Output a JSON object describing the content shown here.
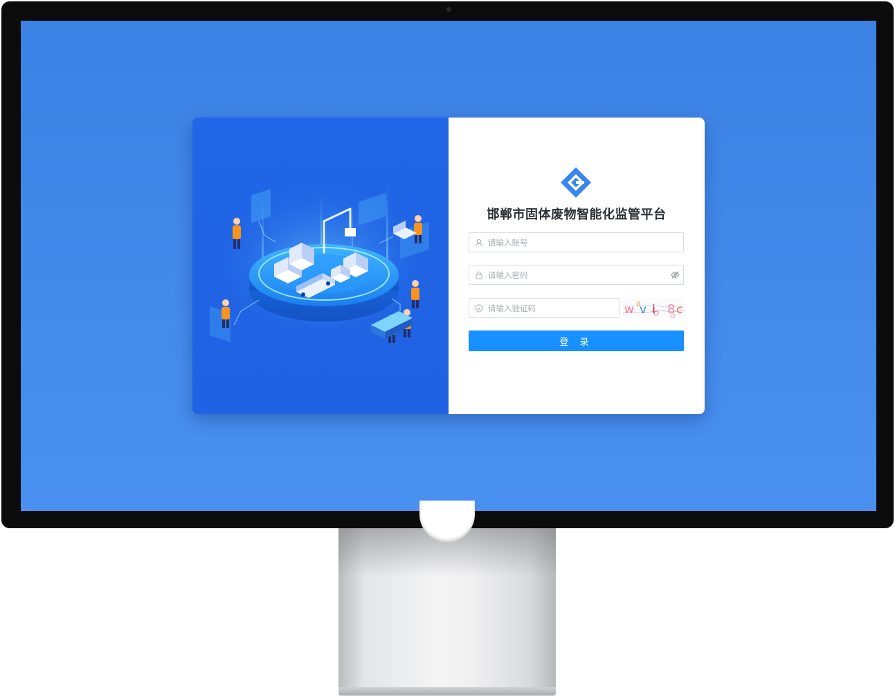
{
  "login": {
    "title": "邯郸市固体废物智能化监管平台",
    "account_placeholder": "请输入账号",
    "password_placeholder": "请输入密码",
    "captcha_placeholder": "请输入验证码",
    "captcha_text": [
      "w",
      "0",
      "v",
      "i",
      "8",
      "c"
    ],
    "login_button": "登 录"
  },
  "icons": {
    "logo": "brand-diamond-logo",
    "account": "user-icon",
    "password": "lock-icon",
    "captcha": "shield-icon",
    "toggle": "eye-off-icon"
  },
  "colors": {
    "screen_background": "#3c82e4",
    "illustration_panel": "#2166e6",
    "primary_button": "#1890ff",
    "title_text": "#2b2f36",
    "placeholder_text": "#a7abb2"
  }
}
